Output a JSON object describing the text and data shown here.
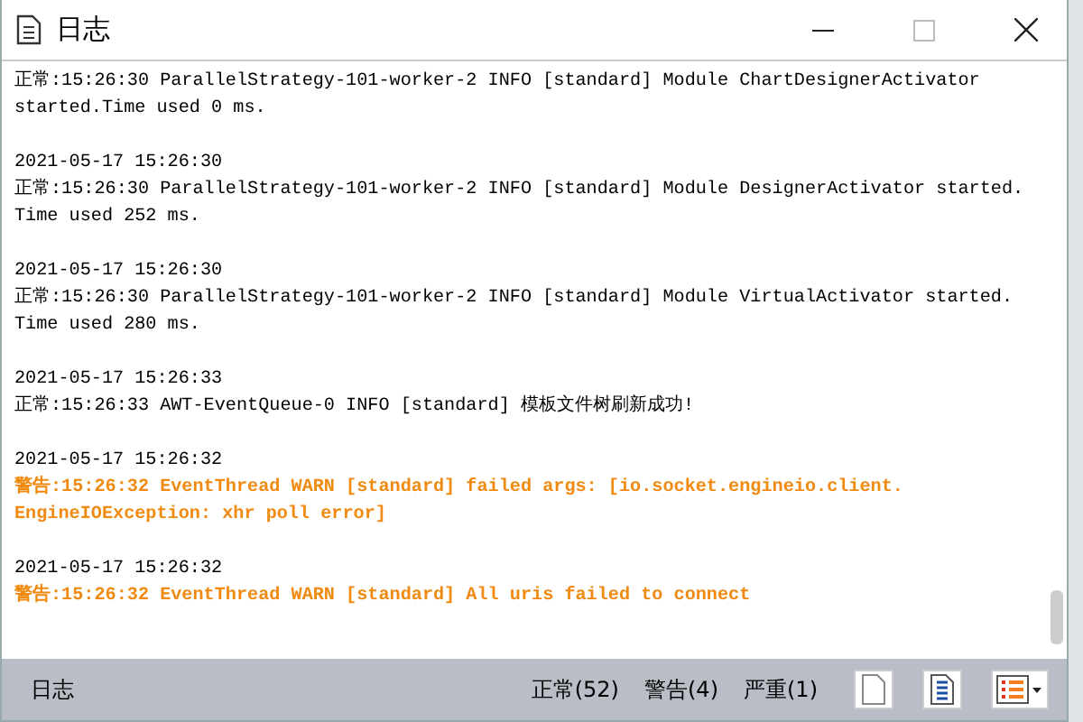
{
  "window": {
    "title": "日志"
  },
  "entries": [
    {
      "kind": "info",
      "lines": [
        "正常:15:26:30 ParallelStrategy-101-worker-2 INFO [standard] Module ChartDesignerActivator",
        "started.Time used 0 ms."
      ]
    },
    {
      "date": "2021-05-17 15:26:30",
      "kind": "info",
      "lines": [
        "正常:15:26:30 ParallelStrategy-101-worker-2 INFO [standard] Module DesignerActivator started.",
        "Time used 252 ms."
      ]
    },
    {
      "date": "2021-05-17 15:26:30",
      "kind": "info",
      "lines": [
        "正常:15:26:30 ParallelStrategy-101-worker-2 INFO [standard] Module VirtualActivator started.",
        "Time used 280 ms."
      ]
    },
    {
      "date": "2021-05-17 15:26:33",
      "kind": "info",
      "lines": [
        "正常:15:26:33 AWT-EventQueue-0 INFO [standard] 模板文件树刷新成功!"
      ]
    },
    {
      "date": "2021-05-17 15:26:32",
      "kind": "warn",
      "lines": [
        "警告:15:26:32 EventThread WARN [standard] failed args: [io.socket.engineio.client.",
        "EngineIOException: xhr poll error]"
      ]
    },
    {
      "date": "2021-05-17 15:26:32",
      "kind": "warn",
      "lines": [
        "警告:15:26:32 EventThread WARN [standard] All uris failed to connect"
      ]
    }
  ],
  "status_bar": {
    "label": "日志",
    "counts": [
      "正常(52)",
      "警告(4)",
      "严重(1)"
    ]
  }
}
